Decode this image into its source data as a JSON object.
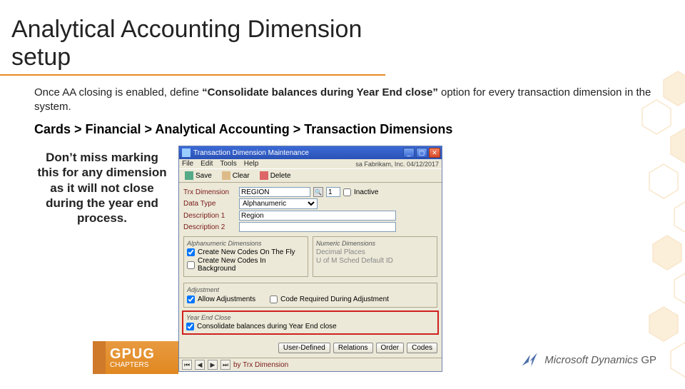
{
  "slide": {
    "title": "Analytical Accounting Dimension setup",
    "body_pre": "Once AA closing is enabled, define ",
    "body_bold": "“Consolidate balances during Year End close” ",
    "body_post": "option for every transaction dimension in the system.",
    "nav_first": "C",
    "nav_rest": "ards > Financial > Analytical Accounting > Transaction Dimensions",
    "callout": "Don’t miss marking this for any dimension as it will not close during the year end process."
  },
  "window": {
    "title": "Transaction Dimension Maintenance",
    "status": "sa  Fabrikam, Inc.  04/12/2017",
    "menu": {
      "file": "File",
      "edit": "Edit",
      "tools": "Tools",
      "help": "Help"
    },
    "toolbar": {
      "save": "Save",
      "clear": "Clear",
      "delete": "Delete"
    },
    "fields": {
      "trx_dim_label": "Trx Dimension",
      "trx_dim_value": "REGION",
      "seq_value": "1",
      "inactive_label": "Inactive",
      "data_type_label": "Data Type",
      "data_type_value": "Alphanumeric",
      "desc1_label": "Description 1",
      "desc1_value": "Region",
      "desc2_label": "Description 2",
      "desc2_value": ""
    },
    "groups": {
      "alpha_title": "Alphanumeric Dimensions",
      "numeric_title": "Numeric Dimensions",
      "create_fly": "Create New Codes On The Fly",
      "create_bg": "Create New Codes In Background",
      "decimal_places": "Decimal Places",
      "uom_default": "U of M Sched Default ID",
      "adjustment_title": "Adjustment",
      "allow_adj": "Allow Adjustments",
      "code_req": "Code Required During Adjustment",
      "yec_title": "Year End Close",
      "consolidate": "Consolidate balances during Year End close"
    },
    "buttons": {
      "user_defined": "User-Defined",
      "relations": "Relations",
      "order": "Order",
      "codes": "Codes"
    },
    "pager": "by Trx Dimension"
  },
  "footer": {
    "gpug_big": "GPUG",
    "gpug_small": "CHAPTERS",
    "ms_name": "Microsoft Dynamics",
    "ms_suffix": " GP"
  }
}
